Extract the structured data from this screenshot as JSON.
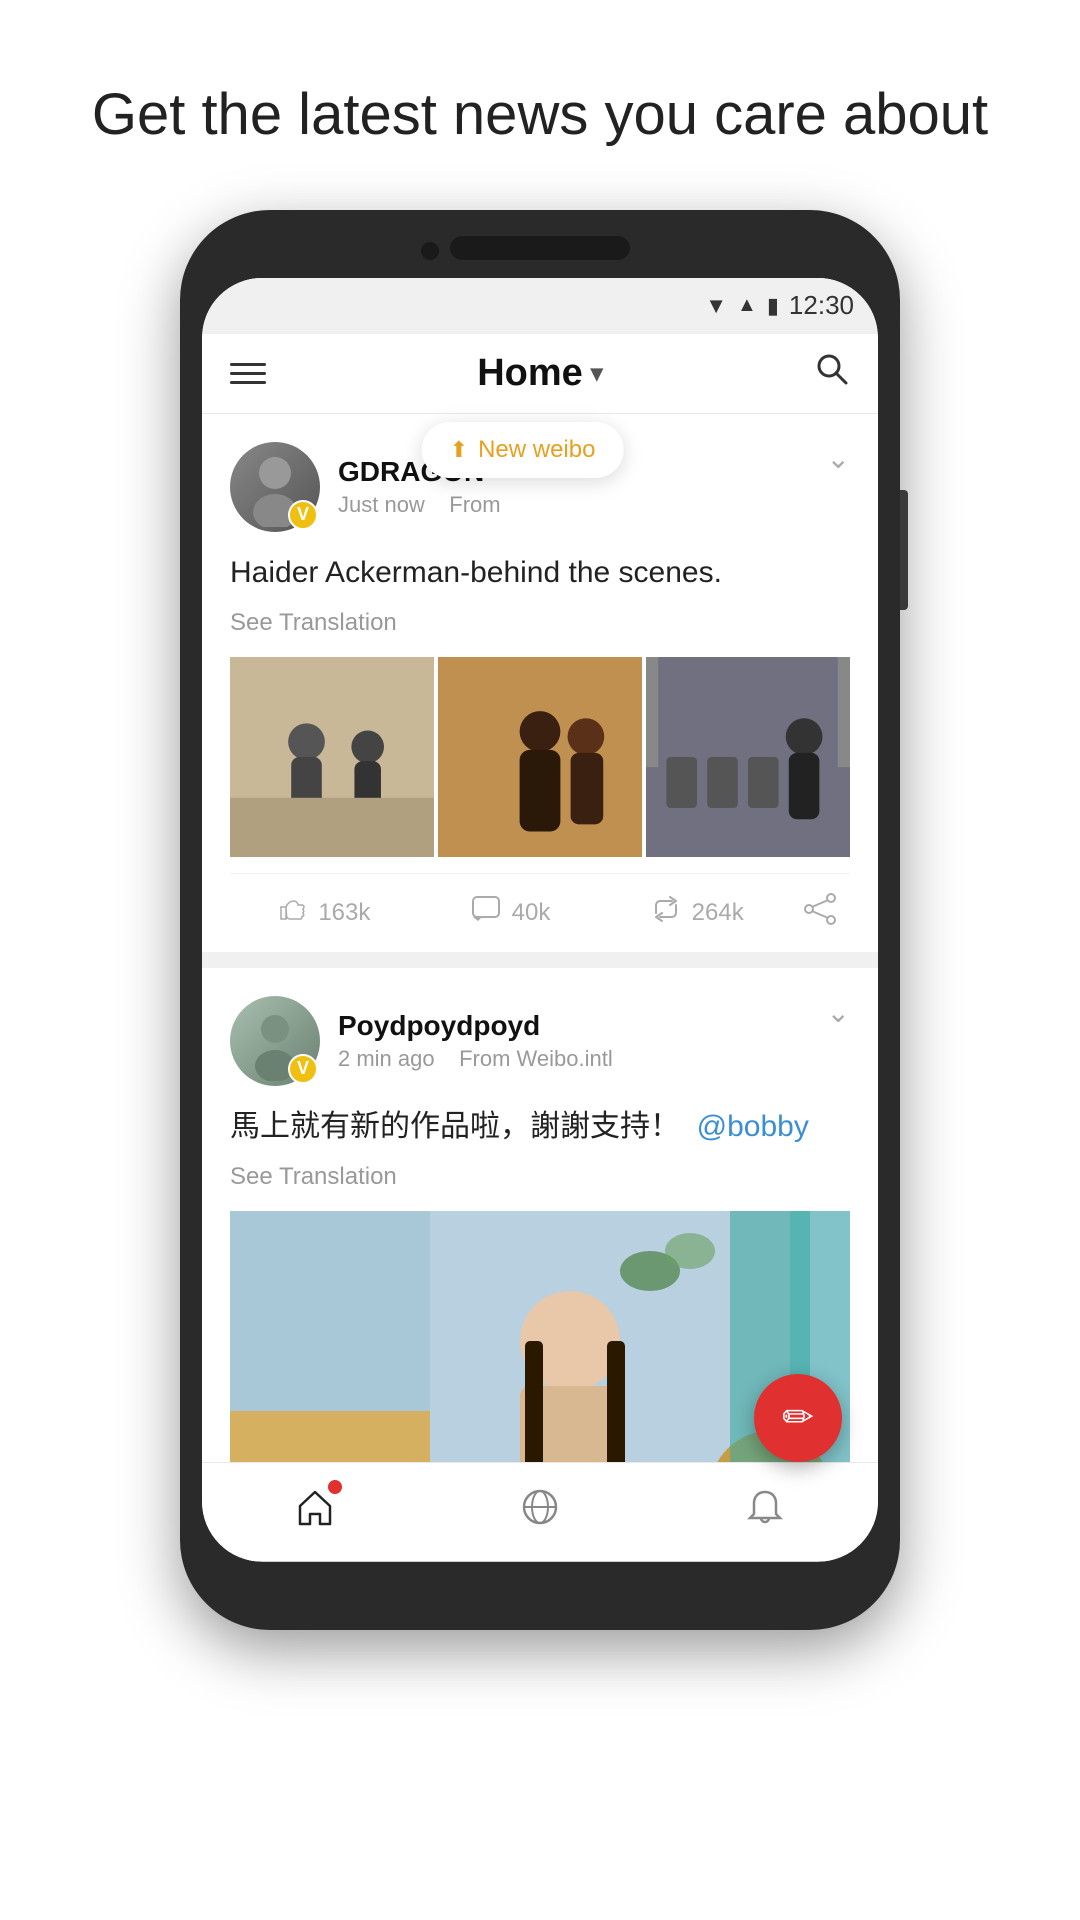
{
  "page": {
    "headline": "Get the latest news you care about"
  },
  "status_bar": {
    "time": "12:30"
  },
  "nav": {
    "title": "Home",
    "menu_label": "Menu",
    "search_label": "Search"
  },
  "new_weibo_toast": {
    "label": "New weibo",
    "arrow": "⬆"
  },
  "posts": [
    {
      "id": "post1",
      "author": "GDRAGON",
      "time": "Just now",
      "source": "From",
      "badge": "V",
      "text": "Haider Ackerman-behind the scenes.",
      "see_translation": "See Translation",
      "likes": "163k",
      "comments": "40k",
      "reposts": "264k"
    },
    {
      "id": "post2",
      "author": "Poydpoydpoyd",
      "time": "2 min ago",
      "source": "From Weibo.intl",
      "badge": "V",
      "text": "馬上就有新的作品啦，謝謝支持！",
      "mention": "@bobby",
      "see_translation": "See Translation",
      "likes": "",
      "comments": "",
      "reposts": ""
    }
  ],
  "fab": {
    "label": "Compose"
  },
  "bottom_nav": {
    "items": [
      {
        "id": "home",
        "label": "Home",
        "active": true
      },
      {
        "id": "explore",
        "label": "Explore",
        "active": false
      },
      {
        "id": "notifications",
        "label": "Notifications",
        "active": false
      }
    ]
  }
}
